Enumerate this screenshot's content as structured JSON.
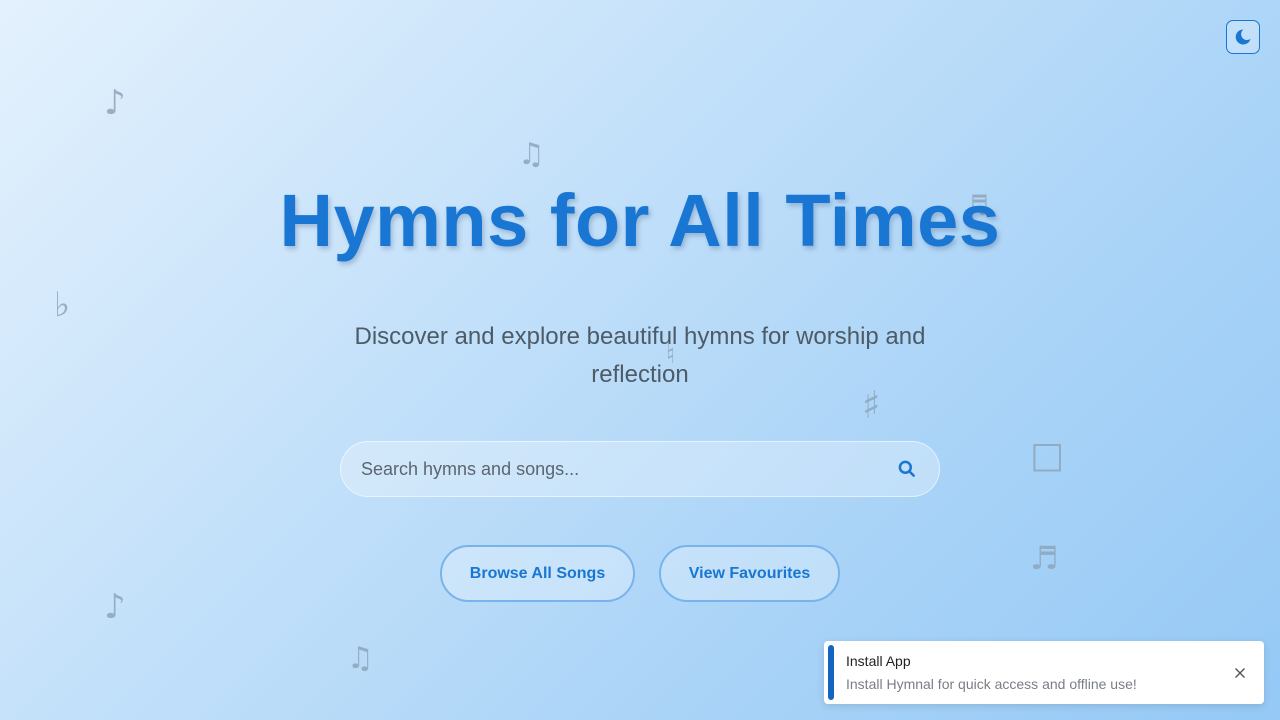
{
  "theme_toggle": {
    "icon": "moon-icon"
  },
  "hero": {
    "title": "Hymns for All Times",
    "subtitle": "Discover and explore beautiful hymns for worship and reflection"
  },
  "search": {
    "placeholder": "Search hymns and songs...",
    "value": "",
    "icon": "search-icon"
  },
  "actions": {
    "browse_label": "Browse All Songs",
    "favourites_label": "View Favourites"
  },
  "install_toast": {
    "title": "Install App",
    "message": "Install Hymnal for quick access and offline use!",
    "close_icon": "close-icon"
  },
  "decorative_notes": [
    "♪",
    "♫",
    "♬",
    "♭",
    "♮",
    "♯",
    "□",
    "♬",
    "♪",
    "♫"
  ],
  "colors": {
    "accent": "#1976d2",
    "toast_accent": "#1565c0",
    "subtitle": "#4d5b66"
  }
}
